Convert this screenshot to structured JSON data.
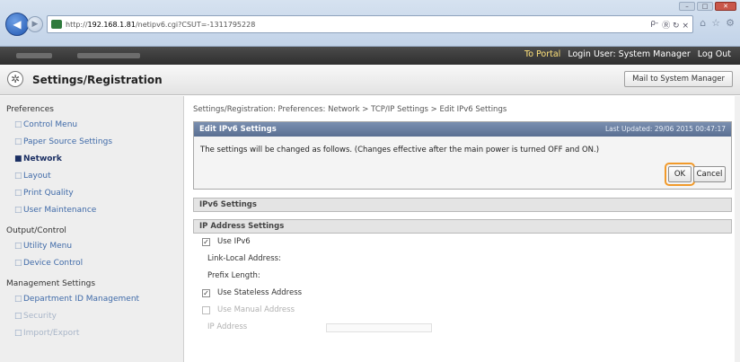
{
  "browser": {
    "url_prefix": "http://",
    "url_host": "192.168.1.81",
    "url_path": "/netipv6.cgi?CSUT=-1311795228",
    "search_glyph": "ρ-",
    "addr_tools": "Ⓡ ↻ ×",
    "home_icon": "⌂",
    "star_icon": "☆",
    "gear_icon": "⚙"
  },
  "topbar": {
    "portal_link": "To Portal",
    "login_user": "Login User: System Manager",
    "logout_link": "Log Out"
  },
  "header": {
    "title": "Settings/Registration",
    "mail_button": "Mail to System Manager"
  },
  "sidebar": {
    "preferences": "Preferences",
    "pref_items": [
      "Control Menu",
      "Paper Source Settings",
      "Network",
      "Layout",
      "Print Quality",
      "User Maintenance"
    ],
    "output_control": "Output/Control",
    "oc_items": [
      "Utility Menu",
      "Device Control"
    ],
    "management": "Management Settings",
    "mgmt_items": [
      "Department ID Management",
      "Security",
      "Import/Export"
    ]
  },
  "main": {
    "breadcrumb": "Settings/Registration: Preferences: Network > TCP/IP Settings > Edit IPv6 Settings",
    "panel_title": "Edit IPv6 Settings",
    "last_updated": "Last Updated: 29/06 2015 00:47:17",
    "message": "The settings will be changed as follows. (Changes effective after the main power is turned OFF and ON.)",
    "ok_label": "OK",
    "cancel_label": "Cancel",
    "ipv6_section": "IPv6 Settings",
    "ip_section": "IP Address Settings",
    "use_ipv6": "Use IPv6",
    "link_local": "Link-Local Address:",
    "prefix_length": "Prefix Length:",
    "use_stateless": "Use Stateless Address",
    "use_manual": "Use Manual Address",
    "ip_address": "IP Address"
  }
}
